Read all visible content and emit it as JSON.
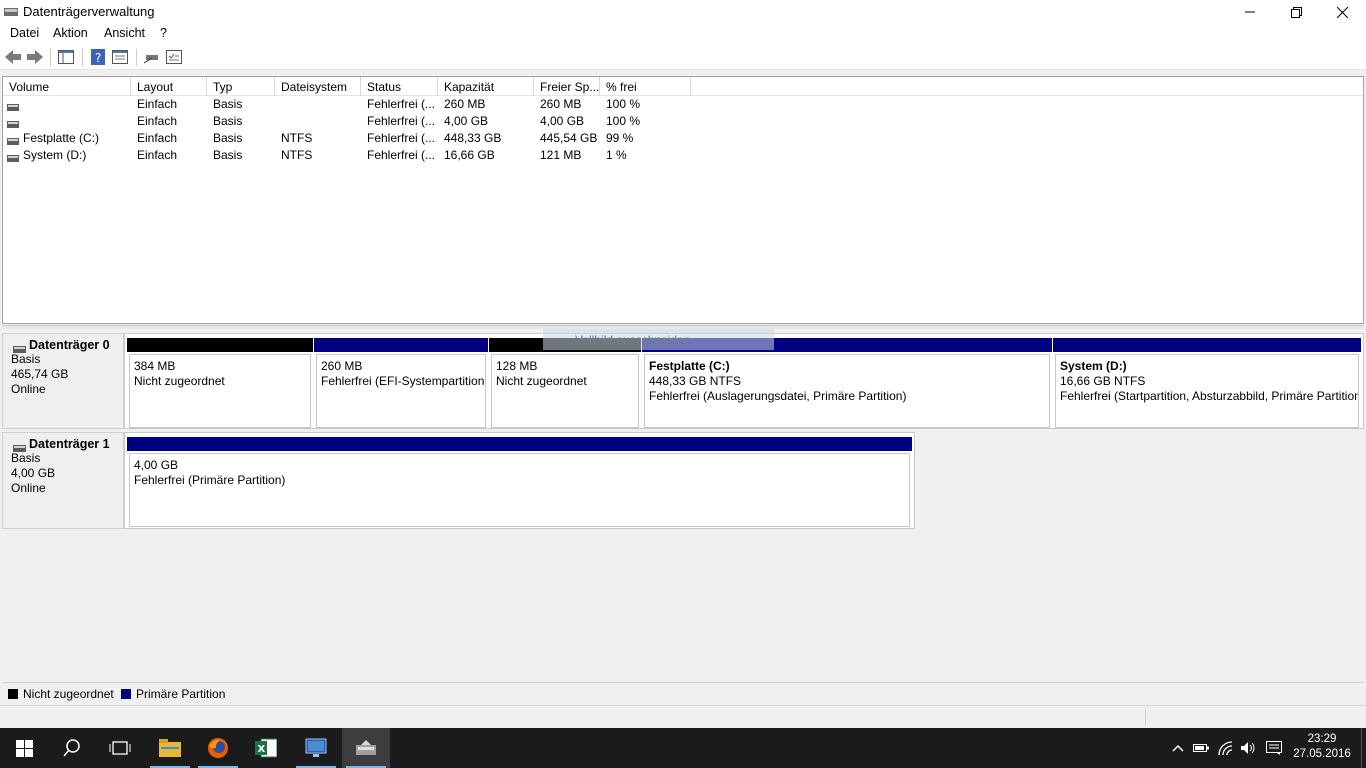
{
  "window": {
    "title": "Datenträgerverwaltung"
  },
  "menu": [
    "Datei",
    "Aktion",
    "Ansicht",
    "?"
  ],
  "columns": [
    "Volume",
    "Layout",
    "Typ",
    "Dateisystem",
    "Status",
    "Kapazität",
    "Freier Sp...",
    "% frei"
  ],
  "volumes": [
    {
      "name": "",
      "layout": "Einfach",
      "type": "Basis",
      "fs": "",
      "status": "Fehlerfrei (...",
      "capacity": "260 MB",
      "free": "260 MB",
      "pct": "100 %"
    },
    {
      "name": "",
      "layout": "Einfach",
      "type": "Basis",
      "fs": "",
      "status": "Fehlerfrei (...",
      "capacity": "4,00 GB",
      "free": "4,00 GB",
      "pct": "100 %"
    },
    {
      "name": "Festplatte (C:)",
      "layout": "Einfach",
      "type": "Basis",
      "fs": "NTFS",
      "status": "Fehlerfrei (...",
      "capacity": "448,33 GB",
      "free": "445,54 GB",
      "pct": "99 %"
    },
    {
      "name": "System (D:)",
      "layout": "Einfach",
      "type": "Basis",
      "fs": "NTFS",
      "status": "Fehlerfrei (...",
      "capacity": "16,66 GB",
      "free": "121 MB",
      "pct": "1 %"
    }
  ],
  "disks": [
    {
      "name": "Datenträger 0",
      "type": "Basis",
      "size": "465,74 GB",
      "state": "Online",
      "partitions": [
        {
          "title": "",
          "line1": "384 MB",
          "line2": "Nicht zugeordnet",
          "kind": "unallocated"
        },
        {
          "title": "",
          "line1": "260 MB",
          "line2": "Fehlerfrei (EFI-Systempartition",
          "kind": "primary"
        },
        {
          "title": "",
          "line1": "128 MB",
          "line2": "Nicht zugeordnet",
          "kind": "unallocated"
        },
        {
          "title": "Festplatte  (C:)",
          "line1": "448,33 GB NTFS",
          "line2": "Fehlerfrei (Auslagerungsdatei, Primäre Partition)",
          "kind": "primary"
        },
        {
          "title": "System  (D:)",
          "line1": "16,66 GB NTFS",
          "line2": "Fehlerfrei (Startpartition, Absturzabbild, Primäre Partition)",
          "kind": "primary"
        }
      ]
    },
    {
      "name": "Datenträger 1",
      "type": "Basis",
      "size": "4,00 GB",
      "state": "Online",
      "partitions": [
        {
          "title": "",
          "line1": "4,00 GB",
          "line2": "Fehlerfrei (Primäre Partition)",
          "kind": "primary"
        }
      ]
    }
  ],
  "overlay_hint": "Vollbild ausschneiden",
  "legend": [
    {
      "label": "Nicht zugeordnet",
      "color": "#000000"
    },
    {
      "label": "Primäre Partition",
      "color": "#000080"
    }
  ],
  "taskbar": {
    "apps": [
      "start-icon",
      "search-icon",
      "task-view-icon",
      "file-explorer-icon",
      "firefox-icon",
      "excel-icon",
      "remote-desktop-icon",
      "disk-management-icon"
    ],
    "time": "23:29",
    "date": "27.05.2016"
  },
  "colors": {
    "primary_partition": "#000080",
    "unallocated": "#000000",
    "taskbar": "#1b1b1b",
    "accent": "#76b9ed"
  }
}
